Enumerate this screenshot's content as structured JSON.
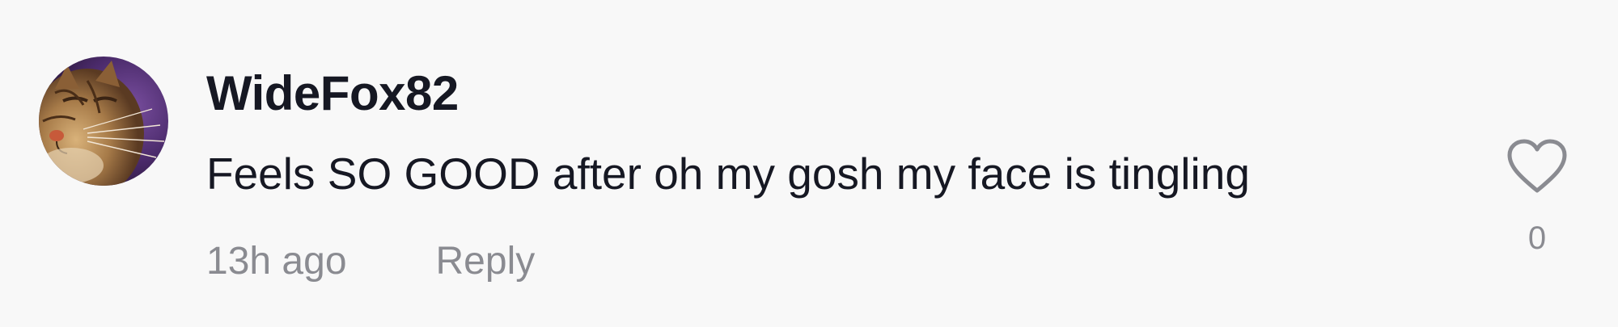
{
  "comment": {
    "username": "WideFox82",
    "text": "Feels SO GOOD after oh my gosh my face is tingling",
    "timestamp": "13h ago",
    "reply_label": "Reply",
    "like_count": "0",
    "avatar_icon": "cat-avatar",
    "like_icon": "heart-outline-icon"
  },
  "colors": {
    "background": "#f8f8f8",
    "primary_text": "#161823",
    "secondary_text": "#8a8b91",
    "icon": "#8a8b91"
  }
}
